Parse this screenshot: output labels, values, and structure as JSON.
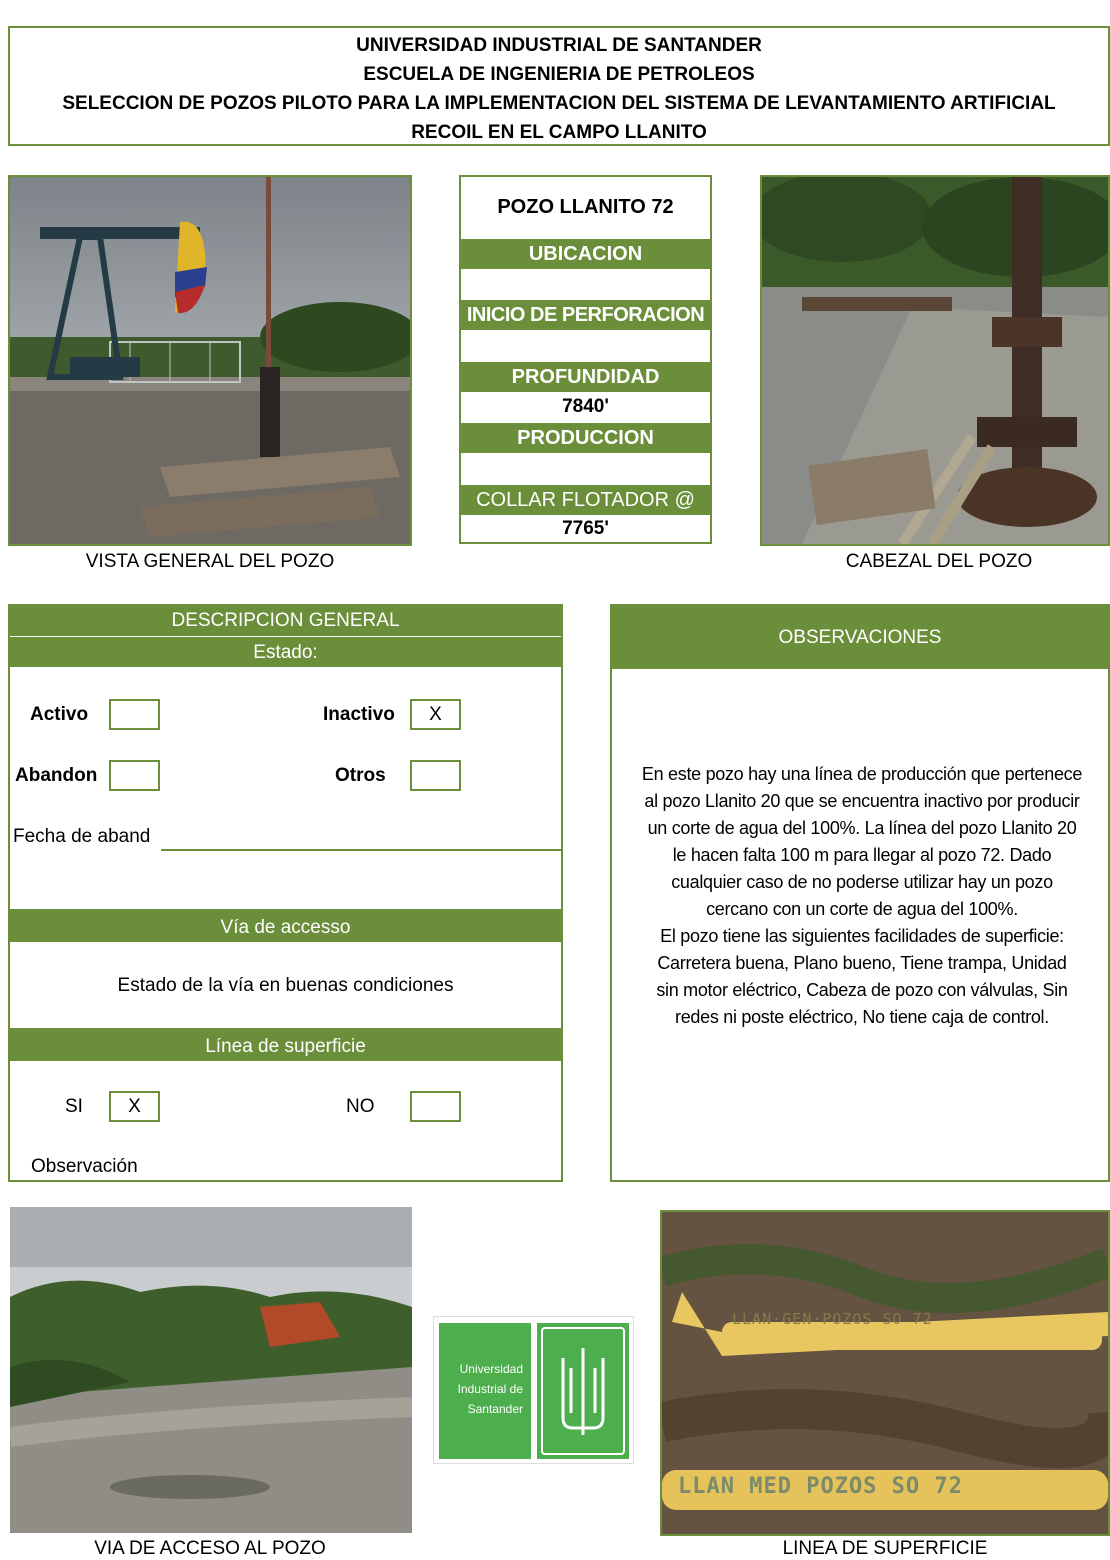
{
  "header": {
    "line1": "UNIVERSIDAD INDUSTRIAL DE SANTANDER",
    "line2": "ESCUELA DE INGENIERIA DE PETROLEOS",
    "line3": "SELECCION DE POZOS PILOTO PARA LA IMPLEMENTACION DEL SISTEMA DE LEVANTAMIENTO ARTIFICIAL",
    "line4": "RECOIL EN EL CAMPO LLANITO"
  },
  "photos": {
    "vista_general_caption": "VISTA GENERAL DEL POZO",
    "cabezal_caption": "CABEZAL DEL POZO",
    "via_caption": "VIA DE ACCESO AL POZO",
    "linea_caption": "LINEA DE SUPERFICIE",
    "pipe_label_top": "LLAN·GEN·POZOS  SO 72",
    "pipe_label_bottom": "LLAN MED POZOS  SO 72"
  },
  "info": {
    "pozo": "POZO LLANITO 72",
    "ubicacion_label": "UBICACION",
    "ubicacion_value": "",
    "inicio_label": "INICIO DE PERFORACION",
    "inicio_value": "",
    "profundidad_label": "PROFUNDIDAD",
    "profundidad_value": "7840'",
    "produccion_label": "PRODUCCION",
    "produccion_value": "",
    "collar_label": "COLLAR FLOTADOR @",
    "collar_value": "7765'"
  },
  "descripcion": {
    "title": "DESCRIPCION GENERAL",
    "estado_label": "Estado:",
    "activo_label": "Activo",
    "activo_value": "",
    "inactivo_label": "Inactivo",
    "inactivo_value": "X",
    "abandon_label": "Abandon",
    "abandon_value": "",
    "otros_label": "Otros",
    "otros_value": "",
    "fecha_label": "Fecha de aband",
    "via_title": "Vía de accesso",
    "via_text": "Estado de la vía en buenas condiciones",
    "linea_title": "Línea de superficie",
    "si_label": "SI",
    "si_value": "X",
    "no_label": "NO",
    "no_value": "",
    "observacion_label": "Observación"
  },
  "observaciones": {
    "title": "OBSERVACIONES",
    "lines": [
      "En este pozo hay una línea de producción que pertenece",
      "al pozo Llanito 20 que se encuentra inactivo por producir",
      "un corte de agua del 100%. La línea del pozo Llanito 20",
      "le hacen falta 100 m para llegar al pozo 72. Dado",
      "cualquier caso de no poderse utilizar hay un pozo",
      "cercano con un corte de agua del 100%.",
      "El pozo tiene las siguientes facilidades de superficie:",
      "Carretera buena, Plano bueno,  Tiene trampa, Unidad",
      "sin motor eléctrico, Cabeza  de pozo con válvulas, Sin",
      "redes ni poste eléctrico, No tiene caja de control."
    ]
  },
  "logo": {
    "line1": "Universidad",
    "line2": "Industrial de",
    "line3": "Santander",
    "mark": "UIS"
  },
  "colors": {
    "green": "#6b8e3a",
    "logo_green": "#4cae4c"
  }
}
